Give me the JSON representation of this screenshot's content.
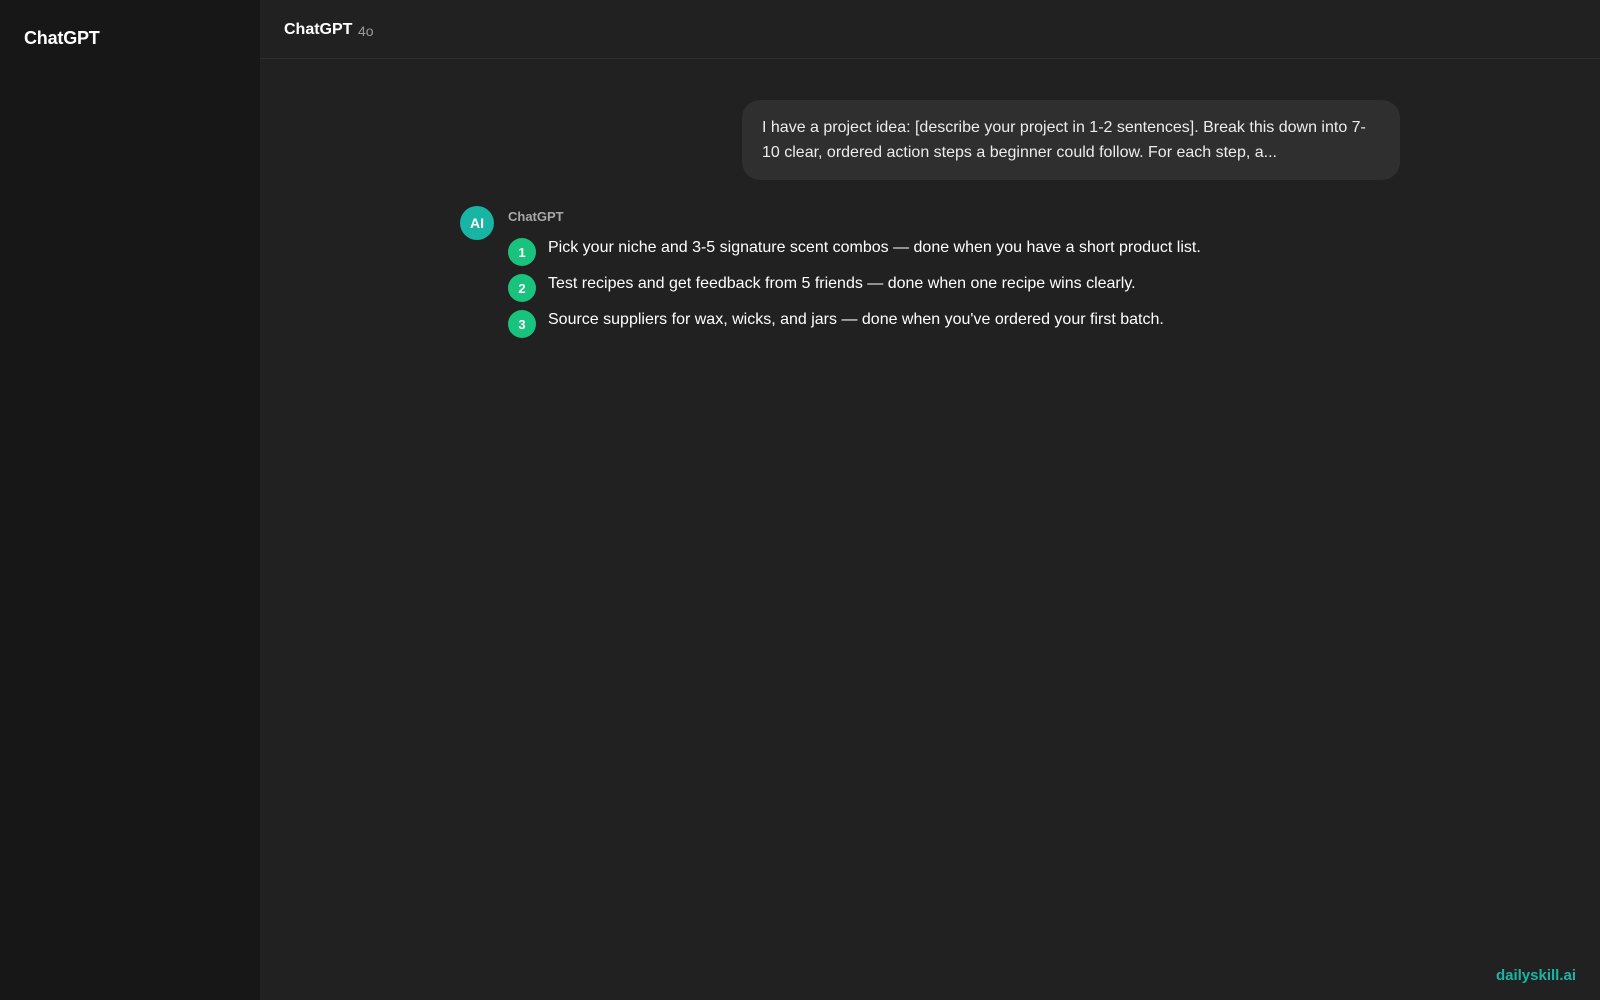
{
  "sidebar": {
    "brand": "ChatGPT"
  },
  "header": {
    "model_name": "ChatGPT",
    "model_version": "4o"
  },
  "conversation": {
    "user_message": "I have a project idea: [describe your project in 1-2 sentences]. Break this down into 7-10 clear, ordered action steps a beginner could follow. For each step, a...",
    "assistant": {
      "avatar_label": "AI",
      "name": "ChatGPT",
      "steps": [
        {
          "number": "1",
          "text": "Pick your niche and 3-5 signature scent combos — done when you have a short product list."
        },
        {
          "number": "2",
          "text": "Test recipes and get feedback from 5 friends — done when one recipe wins clearly."
        },
        {
          "number": "3",
          "text": "Source suppliers for wax, wicks, and jars — done when you've ordered your first batch."
        }
      ]
    }
  },
  "watermark": "dailyskill.ai",
  "colors": {
    "sidebar_bg": "#171717",
    "main_bg": "#212121",
    "user_bubble_bg": "#2f2f2f",
    "avatar_accent": "#19b5a4",
    "step_badge": "#19c37d"
  }
}
